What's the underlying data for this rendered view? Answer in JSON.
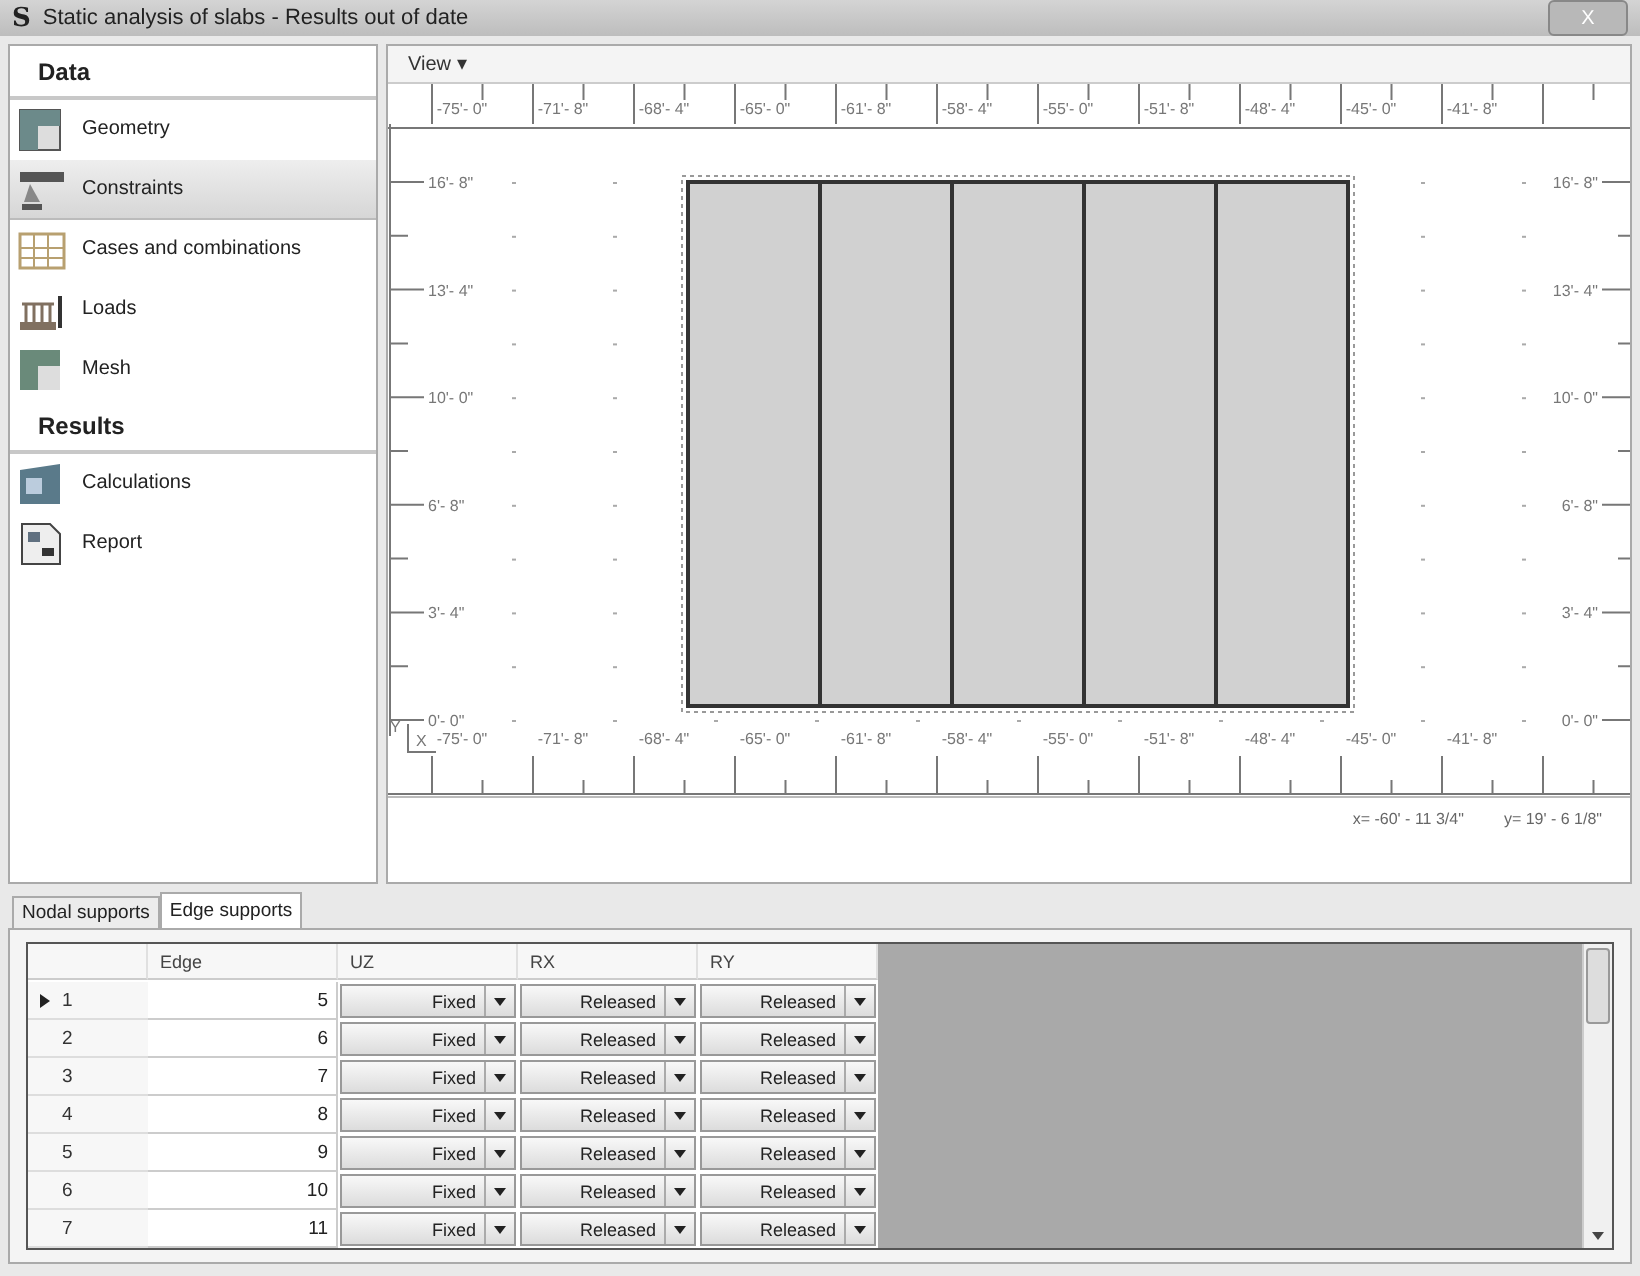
{
  "window": {
    "app_letter": "S",
    "title": "Static analysis of slabs - Results out of date",
    "close": "X"
  },
  "sidebar": {
    "sections": [
      {
        "title": "Data",
        "items": [
          {
            "label": "Geometry",
            "selected": false,
            "kind": "geometry"
          },
          {
            "label": "Constraints",
            "selected": true,
            "kind": "constraints"
          },
          {
            "label": "Cases and combinations",
            "selected": false,
            "kind": "cases"
          },
          {
            "label": "Loads",
            "selected": false,
            "kind": "loads"
          },
          {
            "label": "Mesh",
            "selected": false,
            "kind": "mesh"
          }
        ]
      },
      {
        "title": "Results",
        "items": [
          {
            "label": "Calculations",
            "selected": false,
            "kind": "calculations"
          },
          {
            "label": "Report",
            "selected": false,
            "kind": "report"
          }
        ]
      }
    ]
  },
  "canvas": {
    "menu": "View ▾",
    "x_labels_top": [
      "-75'- 0\"",
      "-71'- 8\"",
      "-68'- 4\"",
      "-65'- 0\"",
      "-61'- 8\"",
      "-58'- 4\"",
      "-55'- 0\"",
      "-51'- 8\"",
      "-48'- 4\"",
      "-45'- 0\"",
      "-41'- 8\""
    ],
    "x_labels_bottom": [
      "-75'- 0\"",
      "-71'- 8\"",
      "-68'- 4\"",
      "-65'- 0\"",
      "-61'- 8\"",
      "-58'- 4\"",
      "-55'- 0\"",
      "-51'- 8\"",
      "-48'- 4\"",
      "-45'- 0\"",
      "-41'- 8\""
    ],
    "y_labels_left": [
      "16'- 8\"",
      "13'- 4\"",
      "10'- 0\"",
      "6'- 8\"",
      "3'- 4\"",
      "0'- 0\""
    ],
    "y_labels_right": [
      "16'- 8\"",
      "13'- 4\"",
      "10'- 0\"",
      "6'- 8\"",
      "3'- 4\"",
      "0'- 0\""
    ],
    "axis_y": "Y",
    "axis_x": "X",
    "coord_x": "x= -60' - 11 3/4\"",
    "coord_y": "y= 19' - 6 1/8\""
  },
  "tabs": [
    {
      "label": "Nodal supports",
      "selected": false
    },
    {
      "label": "Edge supports",
      "selected": true
    }
  ],
  "table": {
    "columns": [
      "Edge",
      "UZ",
      "RX",
      "RY"
    ],
    "rows": [
      {
        "index": "1",
        "current": true,
        "edge": "5",
        "uz": "Fixed",
        "rx": "Released",
        "ry": "Released"
      },
      {
        "index": "2",
        "current": false,
        "edge": "6",
        "uz": "Fixed",
        "rx": "Released",
        "ry": "Released"
      },
      {
        "index": "3",
        "current": false,
        "edge": "7",
        "uz": "Fixed",
        "rx": "Released",
        "ry": "Released"
      },
      {
        "index": "4",
        "current": false,
        "edge": "8",
        "uz": "Fixed",
        "rx": "Released",
        "ry": "Released"
      },
      {
        "index": "5",
        "current": false,
        "edge": "9",
        "uz": "Fixed",
        "rx": "Released",
        "ry": "Released"
      },
      {
        "index": "6",
        "current": false,
        "edge": "10",
        "uz": "Fixed",
        "rx": "Released",
        "ry": "Released"
      },
      {
        "index": "7",
        "current": false,
        "edge": "11",
        "uz": "Fixed",
        "rx": "Released",
        "ry": "Released"
      }
    ]
  }
}
